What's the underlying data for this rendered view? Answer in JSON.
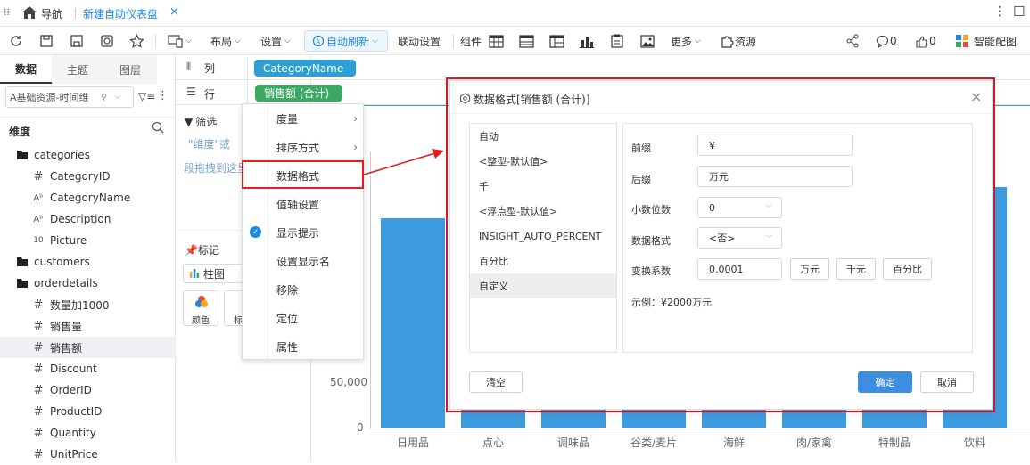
{
  "tabs": {
    "menu_icon": "≡",
    "home_label": "导航",
    "active_tab": "新建自助仪表盘",
    "close": "×",
    "more": "⋮",
    "window": "☐"
  },
  "toolbar": {
    "layout": "布局",
    "settings": "设置",
    "auto_refresh": "自动刷新",
    "linkage": "联动设置",
    "components": "组件",
    "more": "更多",
    "resource": "资源",
    "comments": "0",
    "likes": "0",
    "smart": "智能配图"
  },
  "left": {
    "tabs": [
      "数据",
      "主题",
      "图层"
    ],
    "dataset": "A基础资源-时间维",
    "dim_title": "维度",
    "tree": [
      {
        "type": "folder",
        "label": "categories"
      },
      {
        "type": "num",
        "label": "CategoryID"
      },
      {
        "type": "text",
        "label": "CategoryName"
      },
      {
        "type": "text",
        "label": "Description"
      },
      {
        "type": "img",
        "label": "Picture"
      },
      {
        "type": "folder",
        "label": "customers"
      },
      {
        "type": "folder",
        "label": "orderdetails"
      },
      {
        "type": "num",
        "label": "数量加1000"
      },
      {
        "type": "num",
        "label": "销售量"
      },
      {
        "type": "num",
        "label": "销售额"
      },
      {
        "type": "num",
        "label": "Discount"
      },
      {
        "type": "num",
        "label": "OrderID"
      },
      {
        "type": "num",
        "label": "ProductID"
      },
      {
        "type": "num",
        "label": "Quantity"
      },
      {
        "type": "num",
        "label": "UnitPrice"
      }
    ]
  },
  "mid": {
    "col_label": "列",
    "row_label": "行",
    "col_field": "CategoryName",
    "row_field": "销售额 (合计)",
    "filter_title": "筛选",
    "filter_hint": "\"维度\"或",
    "drag_hint": "段拖拽到这里",
    "mark_title": "标记",
    "chart_type": "柱图",
    "color_label": "颜色",
    "label_label": "标"
  },
  "context_menu": {
    "items": [
      "度量",
      "排序方式",
      "数据格式",
      "值轴设置",
      "显示提示",
      "设置显示名",
      "移除",
      "定位",
      "属性"
    ]
  },
  "dialog": {
    "title": "数据格式[销售额 (合计)]",
    "close": "×",
    "formats": [
      "自动",
      "<整型-默认值>",
      "千",
      "<浮点型-默认值>",
      "INSIGHT_AUTO_PERCENT",
      "百分比",
      "自定义"
    ],
    "prefix_label": "前缀",
    "prefix_value": "¥",
    "suffix_label": "后缀",
    "suffix_value": "万元",
    "decimals_label": "小数位数",
    "decimals_value": "0",
    "format_label": "数据格式",
    "format_value": "<否>",
    "factor_label": "变换系数",
    "factor_value": "0.0001",
    "factor_buttons": [
      "万元",
      "千元",
      "百分比"
    ],
    "example": "示例：¥2000万元",
    "clear": "清空",
    "ok": "确定",
    "cancel": "取消"
  },
  "chart_data": {
    "type": "bar",
    "categories": [
      "日用品",
      "点心",
      "调味品",
      "谷类/麦片",
      "海鲜",
      "肉/家禽",
      "特制品",
      "饮料"
    ],
    "y_ticks": [
      "50,000",
      "0"
    ],
    "values": [
      235000,
      null,
      null,
      null,
      null,
      null,
      null,
      270000
    ],
    "color": "#3d9be0"
  },
  "colors": {
    "accent": "#1e88e5",
    "pill_blue": "#2b9fd6",
    "pill_green": "#3aaa63",
    "red": "#e02020",
    "bar": "#3d9be0"
  }
}
